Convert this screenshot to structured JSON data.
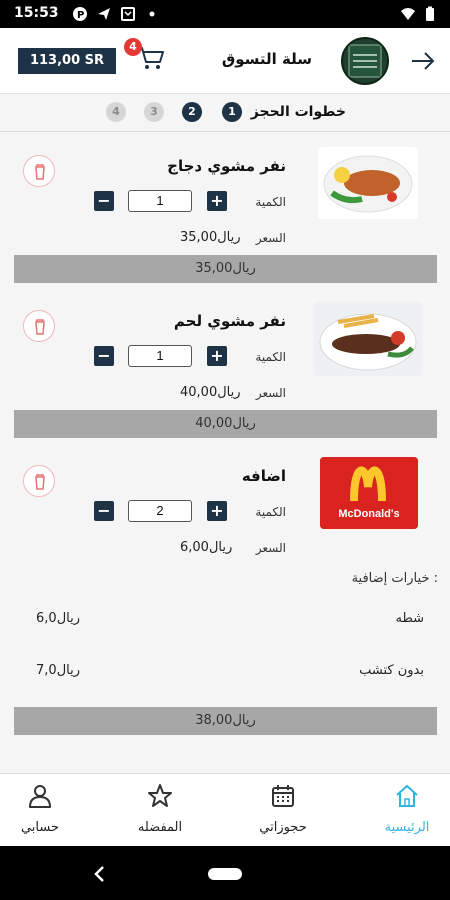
{
  "status_bar": {
    "time": "15:53",
    "icons": [
      "p-icon",
      "send-icon",
      "mail-icon",
      "dot-icon",
      "wifi-icon",
      "battery-icon"
    ]
  },
  "header": {
    "title": "سلة التسوق",
    "total": "113,00 SR",
    "cart_count": "4",
    "logo_icon": "restaurant-logo",
    "back_icon": "arrow-right-icon"
  },
  "steps": {
    "label": "خطوات الحجز",
    "numbers": [
      "1",
      "2",
      "3",
      "4"
    ],
    "active_count": 2
  },
  "items": [
    {
      "name": "نفر مشوي دجاج",
      "qty_label": "الكمية",
      "qty": "1",
      "price_label": "السعر",
      "price": "35,00ريال",
      "subtotal": "35,00ريال",
      "image": "grilled-chicken-plate"
    },
    {
      "name": "نفر مشوي لحم",
      "qty_label": "الكمية",
      "qty": "1",
      "price_label": "السعر",
      "price": "40,00ريال",
      "subtotal": "40,00ريال",
      "image": "grilled-meat-plate"
    },
    {
      "name": "اضافه",
      "qty_label": "الكمية",
      "qty": "2",
      "price_label": "السعر",
      "price": "6,00ريال",
      "image": "mcdonalds-logo",
      "image_text": "McDonald's",
      "extras_title": "خيارات إضافية :",
      "extras": [
        {
          "name": "شطه",
          "price": "6,0ريال"
        },
        {
          "name": "بدون كتشب",
          "price": "7,0ريال"
        }
      ],
      "subtotal": "38,00ريال"
    }
  ],
  "bottom_nav": [
    {
      "label": "الرئيسية",
      "icon": "home-icon",
      "active": true
    },
    {
      "label": "حجوزاتي",
      "icon": "calendar-icon",
      "active": false
    },
    {
      "label": "المفضله",
      "icon": "star-icon",
      "active": false
    },
    {
      "label": "حسابي",
      "icon": "user-icon",
      "active": false
    }
  ],
  "colors": {
    "primary": "#1e3346",
    "accent": "#35b2e0",
    "badge": "#e53935",
    "subtotal_bar": "#a7a7a7"
  }
}
